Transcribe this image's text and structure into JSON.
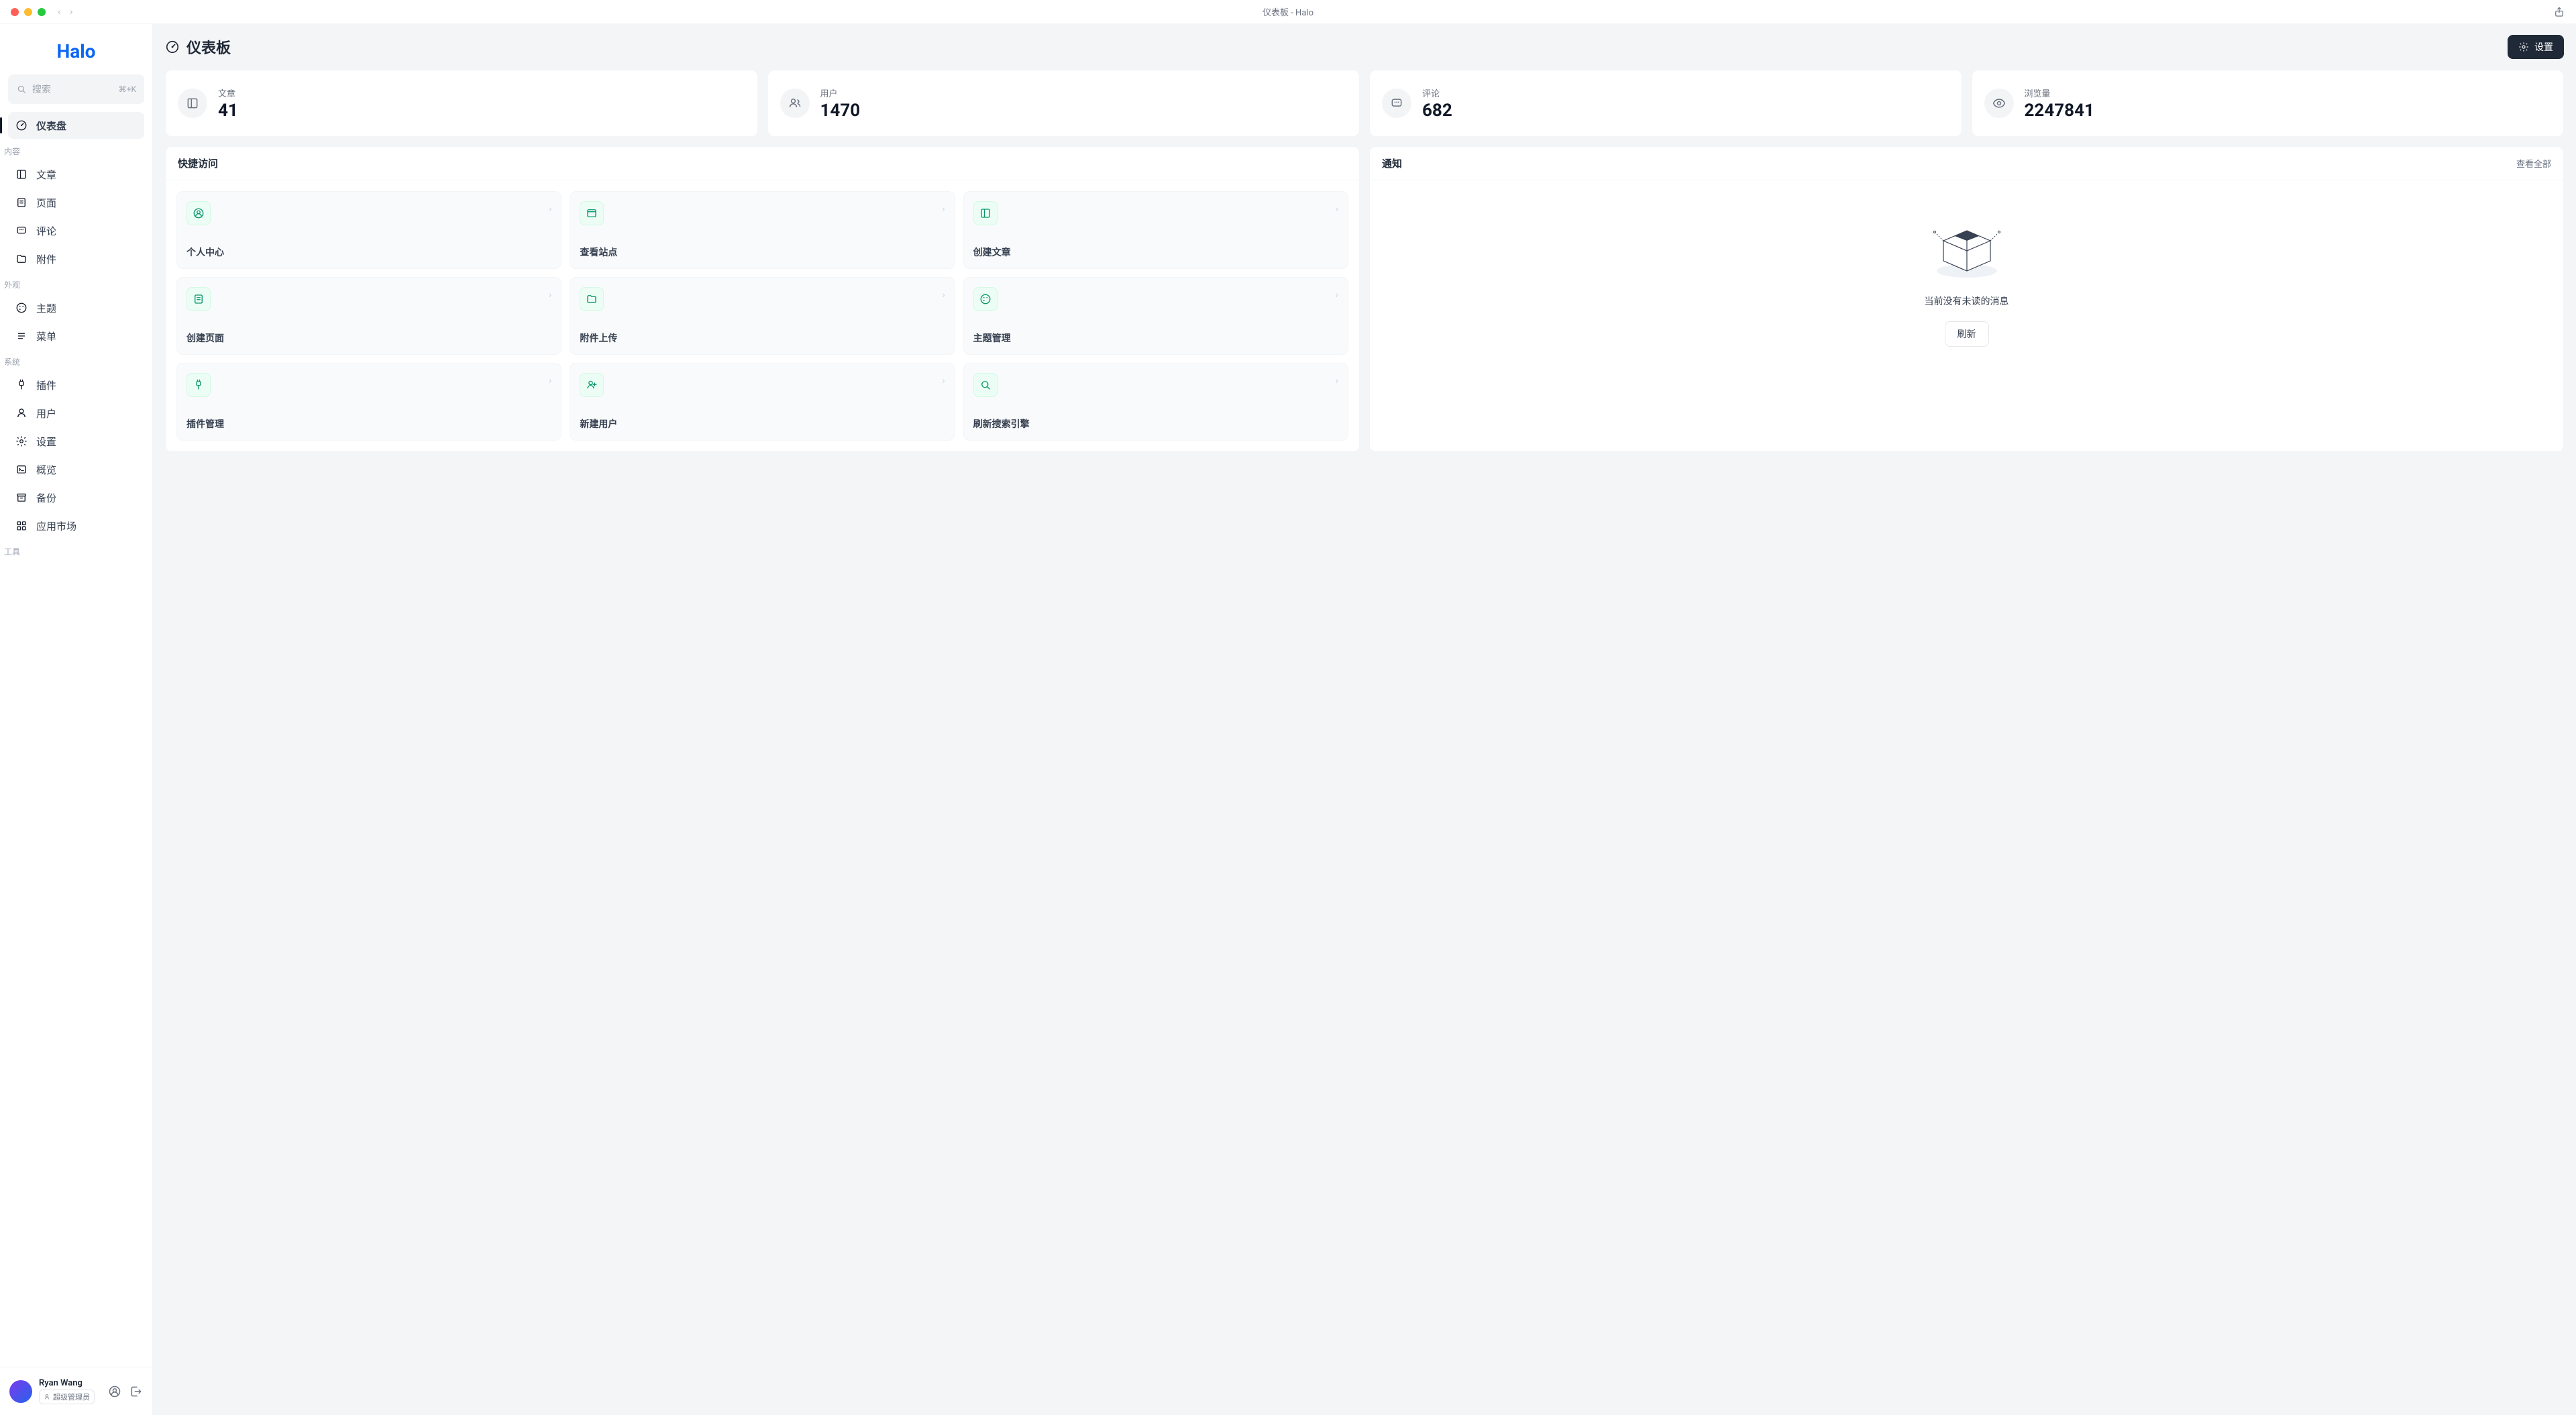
{
  "window": {
    "title": "仪表板 - Halo"
  },
  "brand": "Halo",
  "search": {
    "placeholder": "搜索",
    "shortcut": "⌘+K"
  },
  "sidebar": {
    "dashboard": "仪表盘",
    "sections": [
      {
        "heading": "内容",
        "items": [
          {
            "label": "文章",
            "icon": "book"
          },
          {
            "label": "页面",
            "icon": "pages"
          },
          {
            "label": "评论",
            "icon": "message"
          },
          {
            "label": "附件",
            "icon": "folder"
          }
        ]
      },
      {
        "heading": "外观",
        "items": [
          {
            "label": "主题",
            "icon": "palette"
          },
          {
            "label": "菜单",
            "icon": "list"
          }
        ]
      },
      {
        "heading": "系统",
        "items": [
          {
            "label": "插件",
            "icon": "plug"
          },
          {
            "label": "用户",
            "icon": "user"
          },
          {
            "label": "设置",
            "icon": "gear"
          },
          {
            "label": "概览",
            "icon": "terminal"
          },
          {
            "label": "备份",
            "icon": "archive"
          },
          {
            "label": "应用市场",
            "icon": "grid"
          }
        ]
      },
      {
        "heading": "工具",
        "items": []
      }
    ]
  },
  "footer": {
    "name": "Ryan Wang",
    "role": "超级管理员"
  },
  "page": {
    "title": "仪表板",
    "settings_btn": "设置"
  },
  "stats": [
    {
      "label": "文章",
      "value": "41",
      "icon": "book"
    },
    {
      "label": "用户",
      "value": "1470",
      "icon": "users"
    },
    {
      "label": "评论",
      "value": "682",
      "icon": "message"
    },
    {
      "label": "浏览量",
      "value": "2247841",
      "icon": "eye"
    }
  ],
  "quick": {
    "title": "快捷访问",
    "items": [
      {
        "label": "个人中心",
        "icon": "account"
      },
      {
        "label": "查看站点",
        "icon": "window"
      },
      {
        "label": "创建文章",
        "icon": "book"
      },
      {
        "label": "创建页面",
        "icon": "pages"
      },
      {
        "label": "附件上传",
        "icon": "folder"
      },
      {
        "label": "主题管理",
        "icon": "palette"
      },
      {
        "label": "插件管理",
        "icon": "plug"
      },
      {
        "label": "新建用户",
        "icon": "userplus"
      },
      {
        "label": "刷新搜索引擎",
        "icon": "search"
      }
    ]
  },
  "notifications": {
    "title": "通知",
    "view_all": "查看全部",
    "empty": "当前没有未读的消息",
    "refresh": "刷新"
  }
}
